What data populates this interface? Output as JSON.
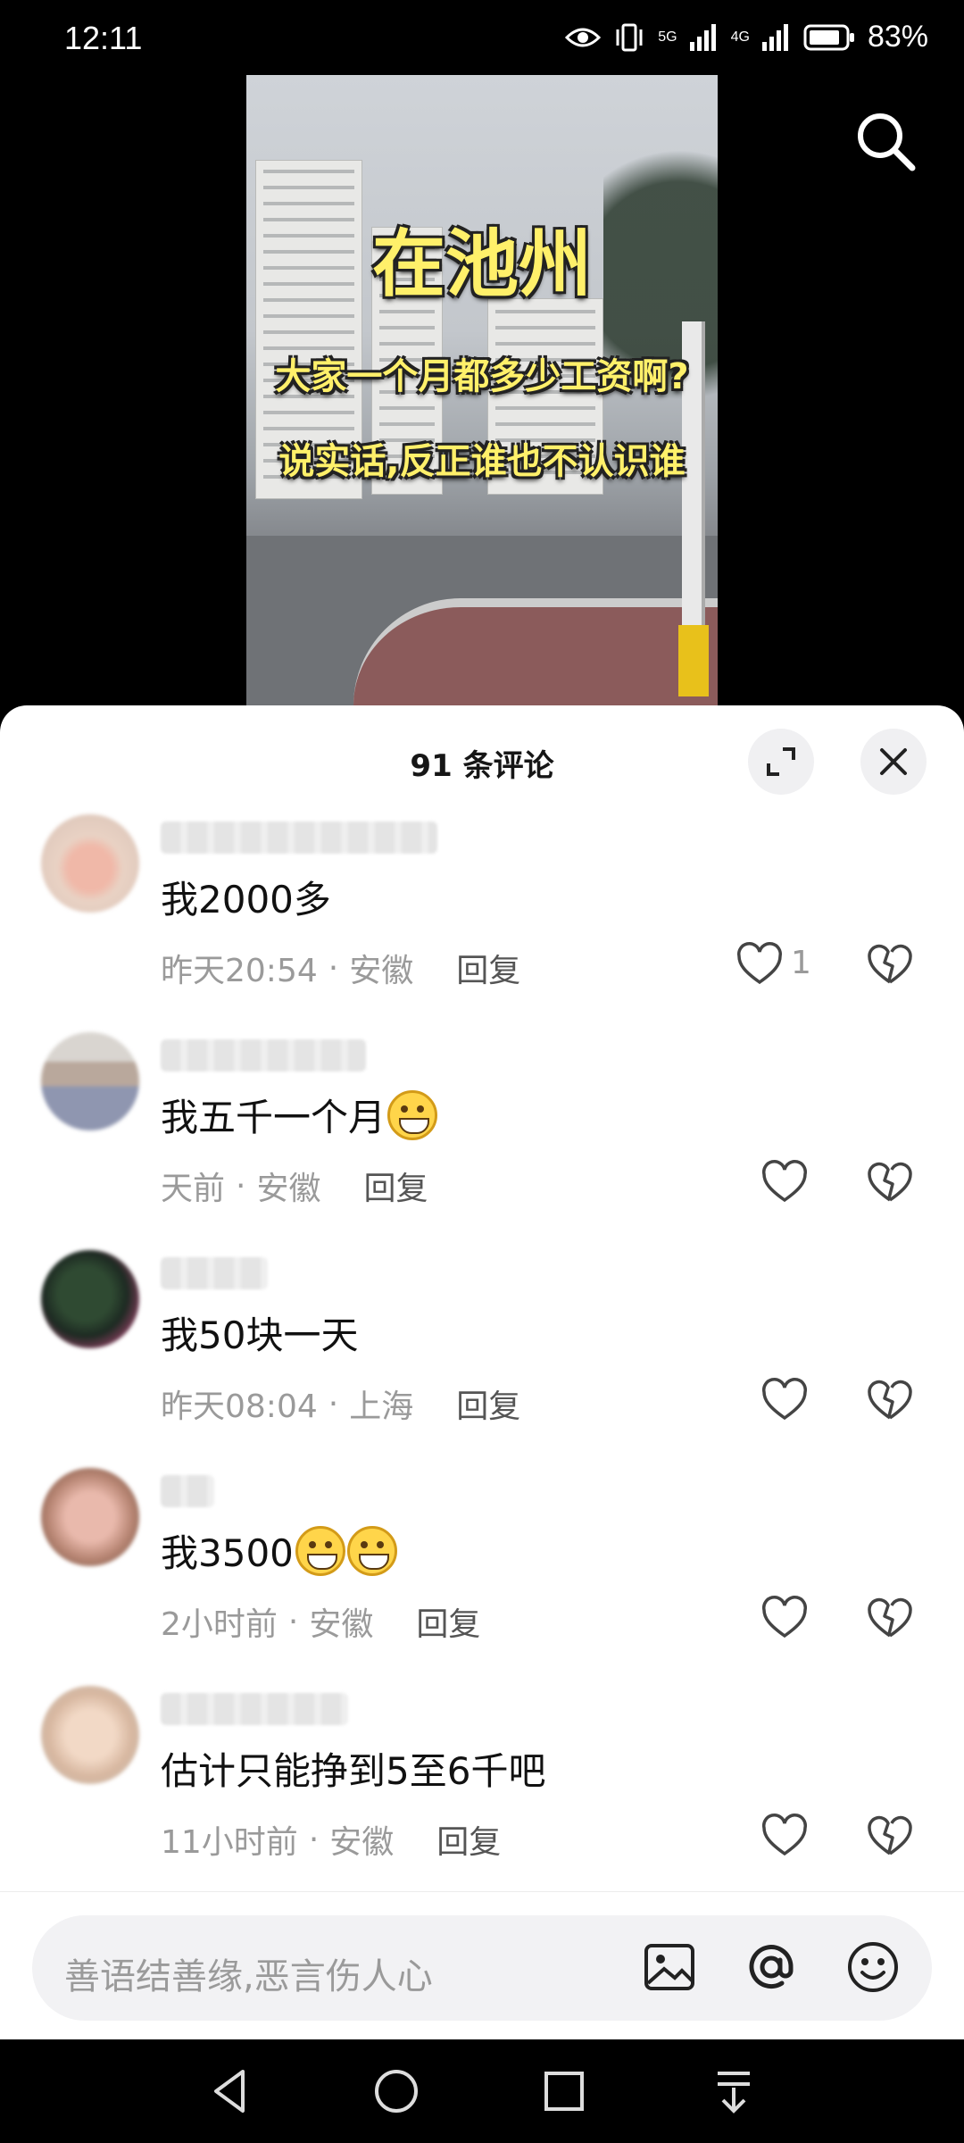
{
  "status_bar": {
    "time": "12:11",
    "network_1": "5G",
    "network_2": "4G",
    "battery": "83%"
  },
  "video": {
    "title": "在池州",
    "line_1": "大家一个月都多少工资啊?",
    "line_2": "说实话,反正谁也不认识谁"
  },
  "comments_sheet": {
    "title": "91 条评论",
    "comments": [
      {
        "text": "我2000多",
        "time": "昨天20:54",
        "location": "安徽",
        "reply": "回复",
        "likes": "1",
        "emoji_count": 0
      },
      {
        "text": "我五千一个月",
        "time": "天前",
        "location": "安徽",
        "reply": "回复",
        "likes": "",
        "emoji_count": 1
      },
      {
        "text": "我50块一天",
        "time": "昨天08:04",
        "location": "上海",
        "reply": "回复",
        "likes": "",
        "emoji_count": 0
      },
      {
        "text": "我3500",
        "time": "2小时前",
        "location": "安徽",
        "reply": "回复",
        "likes": "",
        "emoji_count": 2
      },
      {
        "text": "估计只能挣到5至6千吧",
        "time": "11小时前",
        "location": "安徽",
        "reply": "回复",
        "likes": "",
        "emoji_count": 0
      }
    ],
    "dot_separator": "·"
  },
  "input_bar": {
    "placeholder": "善语结善缘,恶言伤人心"
  },
  "icons": [
    "search-icon",
    "expand-icon",
    "close-icon",
    "heart-icon",
    "broken-heart-icon",
    "image-icon",
    "at-icon",
    "emoji-icon",
    "back-icon",
    "home-icon",
    "recents-icon",
    "menu-icon"
  ]
}
